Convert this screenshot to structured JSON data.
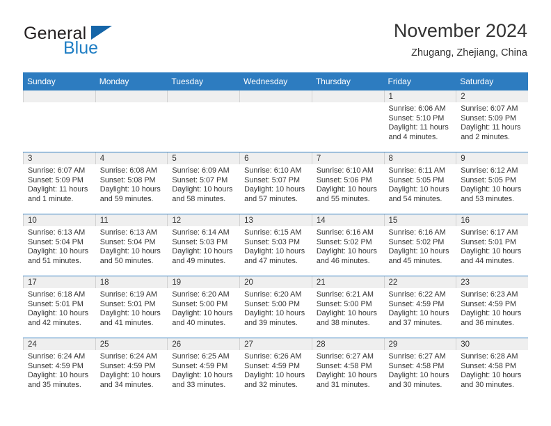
{
  "brand": {
    "name_part1": "General",
    "name_part2": "Blue",
    "triangle_icon": "triangle-icon",
    "color_dark": "#231f20",
    "color_blue": "#1f7ec4"
  },
  "header": {
    "title": "November 2024",
    "subtitle": "Zhugang, Zhejiang, China"
  },
  "theme": {
    "header_bar": "#2d7cc0",
    "daynum_strip": "#efefef",
    "row_divider": "#2d7cc0",
    "text": "#333333"
  },
  "weekdays": [
    "Sunday",
    "Monday",
    "Tuesday",
    "Wednesday",
    "Thursday",
    "Friday",
    "Saturday"
  ],
  "weeks": [
    [
      {
        "day": "",
        "lines": []
      },
      {
        "day": "",
        "lines": []
      },
      {
        "day": "",
        "lines": []
      },
      {
        "day": "",
        "lines": []
      },
      {
        "day": "",
        "lines": []
      },
      {
        "day": "1",
        "lines": [
          "Sunrise: 6:06 AM",
          "Sunset: 5:10 PM",
          "Daylight: 11 hours",
          "and 4 minutes."
        ]
      },
      {
        "day": "2",
        "lines": [
          "Sunrise: 6:07 AM",
          "Sunset: 5:09 PM",
          "Daylight: 11 hours",
          "and 2 minutes."
        ]
      }
    ],
    [
      {
        "day": "3",
        "lines": [
          "Sunrise: 6:07 AM",
          "Sunset: 5:09 PM",
          "Daylight: 11 hours",
          "and 1 minute."
        ]
      },
      {
        "day": "4",
        "lines": [
          "Sunrise: 6:08 AM",
          "Sunset: 5:08 PM",
          "Daylight: 10 hours",
          "and 59 minutes."
        ]
      },
      {
        "day": "5",
        "lines": [
          "Sunrise: 6:09 AM",
          "Sunset: 5:07 PM",
          "Daylight: 10 hours",
          "and 58 minutes."
        ]
      },
      {
        "day": "6",
        "lines": [
          "Sunrise: 6:10 AM",
          "Sunset: 5:07 PM",
          "Daylight: 10 hours",
          "and 57 minutes."
        ]
      },
      {
        "day": "7",
        "lines": [
          "Sunrise: 6:10 AM",
          "Sunset: 5:06 PM",
          "Daylight: 10 hours",
          "and 55 minutes."
        ]
      },
      {
        "day": "8",
        "lines": [
          "Sunrise: 6:11 AM",
          "Sunset: 5:05 PM",
          "Daylight: 10 hours",
          "and 54 minutes."
        ]
      },
      {
        "day": "9",
        "lines": [
          "Sunrise: 6:12 AM",
          "Sunset: 5:05 PM",
          "Daylight: 10 hours",
          "and 53 minutes."
        ]
      }
    ],
    [
      {
        "day": "10",
        "lines": [
          "Sunrise: 6:13 AM",
          "Sunset: 5:04 PM",
          "Daylight: 10 hours",
          "and 51 minutes."
        ]
      },
      {
        "day": "11",
        "lines": [
          "Sunrise: 6:13 AM",
          "Sunset: 5:04 PM",
          "Daylight: 10 hours",
          "and 50 minutes."
        ]
      },
      {
        "day": "12",
        "lines": [
          "Sunrise: 6:14 AM",
          "Sunset: 5:03 PM",
          "Daylight: 10 hours",
          "and 49 minutes."
        ]
      },
      {
        "day": "13",
        "lines": [
          "Sunrise: 6:15 AM",
          "Sunset: 5:03 PM",
          "Daylight: 10 hours",
          "and 47 minutes."
        ]
      },
      {
        "day": "14",
        "lines": [
          "Sunrise: 6:16 AM",
          "Sunset: 5:02 PM",
          "Daylight: 10 hours",
          "and 46 minutes."
        ]
      },
      {
        "day": "15",
        "lines": [
          "Sunrise: 6:16 AM",
          "Sunset: 5:02 PM",
          "Daylight: 10 hours",
          "and 45 minutes."
        ]
      },
      {
        "day": "16",
        "lines": [
          "Sunrise: 6:17 AM",
          "Sunset: 5:01 PM",
          "Daylight: 10 hours",
          "and 44 minutes."
        ]
      }
    ],
    [
      {
        "day": "17",
        "lines": [
          "Sunrise: 6:18 AM",
          "Sunset: 5:01 PM",
          "Daylight: 10 hours",
          "and 42 minutes."
        ]
      },
      {
        "day": "18",
        "lines": [
          "Sunrise: 6:19 AM",
          "Sunset: 5:01 PM",
          "Daylight: 10 hours",
          "and 41 minutes."
        ]
      },
      {
        "day": "19",
        "lines": [
          "Sunrise: 6:20 AM",
          "Sunset: 5:00 PM",
          "Daylight: 10 hours",
          "and 40 minutes."
        ]
      },
      {
        "day": "20",
        "lines": [
          "Sunrise: 6:20 AM",
          "Sunset: 5:00 PM",
          "Daylight: 10 hours",
          "and 39 minutes."
        ]
      },
      {
        "day": "21",
        "lines": [
          "Sunrise: 6:21 AM",
          "Sunset: 5:00 PM",
          "Daylight: 10 hours",
          "and 38 minutes."
        ]
      },
      {
        "day": "22",
        "lines": [
          "Sunrise: 6:22 AM",
          "Sunset: 4:59 PM",
          "Daylight: 10 hours",
          "and 37 minutes."
        ]
      },
      {
        "day": "23",
        "lines": [
          "Sunrise: 6:23 AM",
          "Sunset: 4:59 PM",
          "Daylight: 10 hours",
          "and 36 minutes."
        ]
      }
    ],
    [
      {
        "day": "24",
        "lines": [
          "Sunrise: 6:24 AM",
          "Sunset: 4:59 PM",
          "Daylight: 10 hours",
          "and 35 minutes."
        ]
      },
      {
        "day": "25",
        "lines": [
          "Sunrise: 6:24 AM",
          "Sunset: 4:59 PM",
          "Daylight: 10 hours",
          "and 34 minutes."
        ]
      },
      {
        "day": "26",
        "lines": [
          "Sunrise: 6:25 AM",
          "Sunset: 4:59 PM",
          "Daylight: 10 hours",
          "and 33 minutes."
        ]
      },
      {
        "day": "27",
        "lines": [
          "Sunrise: 6:26 AM",
          "Sunset: 4:59 PM",
          "Daylight: 10 hours",
          "and 32 minutes."
        ]
      },
      {
        "day": "28",
        "lines": [
          "Sunrise: 6:27 AM",
          "Sunset: 4:58 PM",
          "Daylight: 10 hours",
          "and 31 minutes."
        ]
      },
      {
        "day": "29",
        "lines": [
          "Sunrise: 6:27 AM",
          "Sunset: 4:58 PM",
          "Daylight: 10 hours",
          "and 30 minutes."
        ]
      },
      {
        "day": "30",
        "lines": [
          "Sunrise: 6:28 AM",
          "Sunset: 4:58 PM",
          "Daylight: 10 hours",
          "and 30 minutes."
        ]
      }
    ]
  ]
}
